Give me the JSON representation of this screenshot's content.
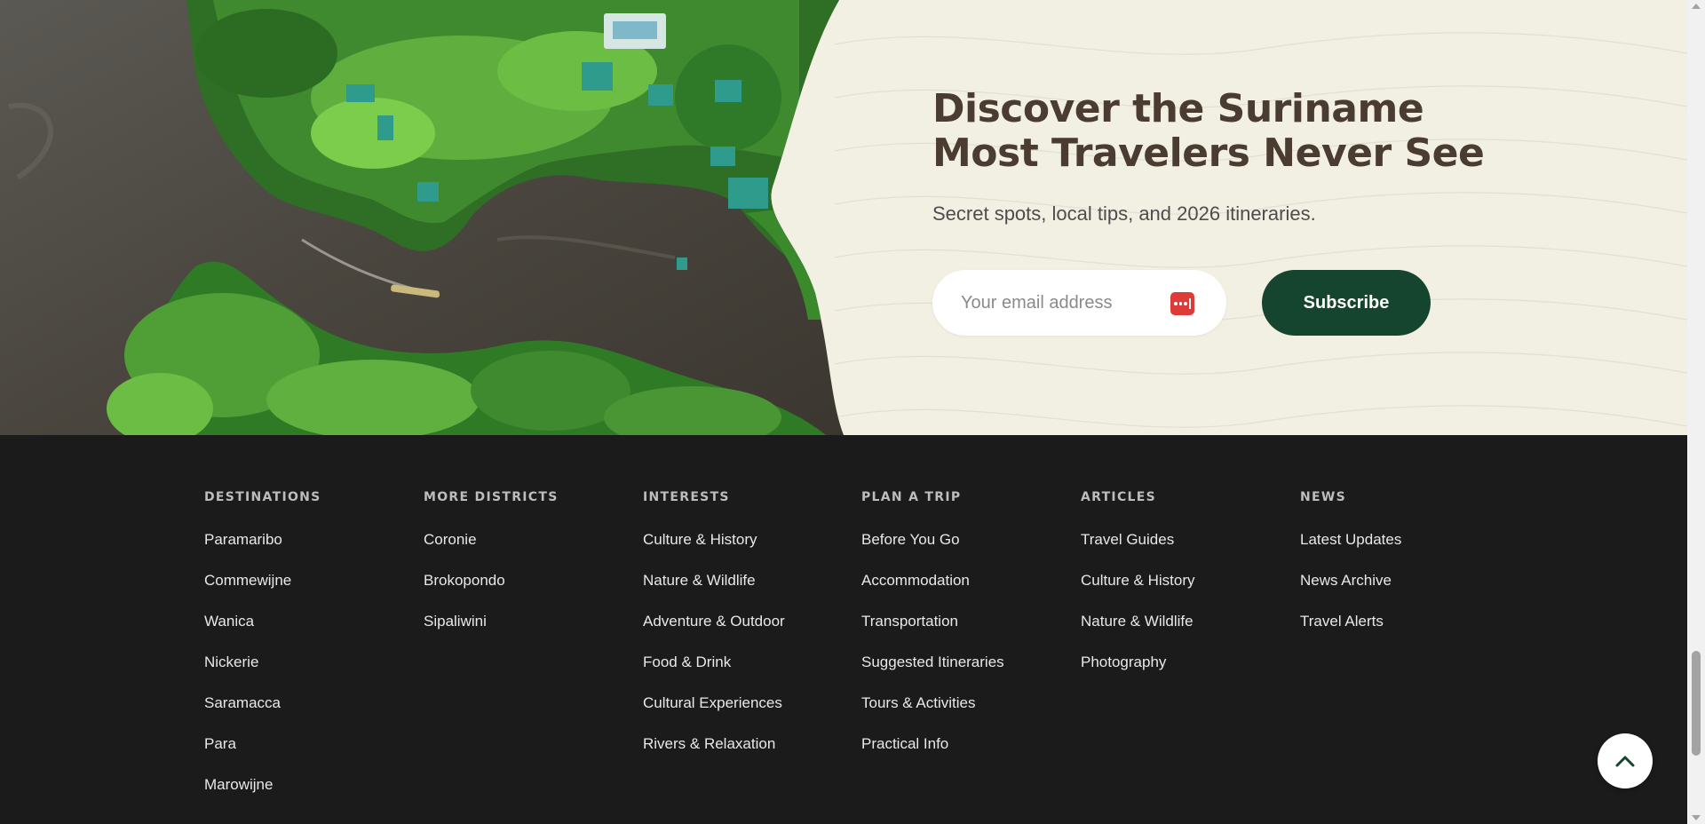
{
  "newsletter": {
    "title_line1": "Discover the Suriname",
    "title_line2": "Most Travelers Never See",
    "subtitle": "Secret spots, local tips, and 2026 itineraries.",
    "email_placeholder": "Your email address",
    "subscribe_label": "Subscribe",
    "colors": {
      "background": "#f2efe3",
      "title": "#4a3c30",
      "button": "#16452f",
      "password_icon": "#dc3b38"
    },
    "photo_icon": "aerial-river-jungle-lodge"
  },
  "footer": {
    "columns": [
      {
        "title": "DESTINATIONS",
        "links": [
          "Paramaribo",
          "Commewijne",
          "Wanica",
          "Nickerie",
          "Saramacca",
          "Para",
          "Marowijne"
        ]
      },
      {
        "title": "MORE DISTRICTS",
        "links": [
          "Coronie",
          "Brokopondo",
          "Sipaliwini"
        ]
      },
      {
        "title": "INTERESTS",
        "links": [
          "Culture & History",
          "Nature & Wildlife",
          "Adventure & Outdoor",
          "Food & Drink",
          "Cultural Experiences",
          "Rivers & Relaxation"
        ]
      },
      {
        "title": "PLAN A TRIP",
        "links": [
          "Before You Go",
          "Accommodation",
          "Transportation",
          "Suggested Itineraries",
          "Tours & Activities",
          "Practical Info"
        ]
      },
      {
        "title": "ARTICLES",
        "links": [
          "Travel Guides",
          "Culture & History",
          "Nature & Wildlife",
          "Photography"
        ]
      },
      {
        "title": "NEWS",
        "links": [
          "Latest Updates",
          "News Archive",
          "Travel Alerts"
        ]
      }
    ],
    "colors": {
      "background": "#1b1b1b",
      "heading": "#bdbdbd",
      "link": "#e8e8e8"
    }
  },
  "back_to_top": {
    "icon": "chevron-up-icon"
  }
}
